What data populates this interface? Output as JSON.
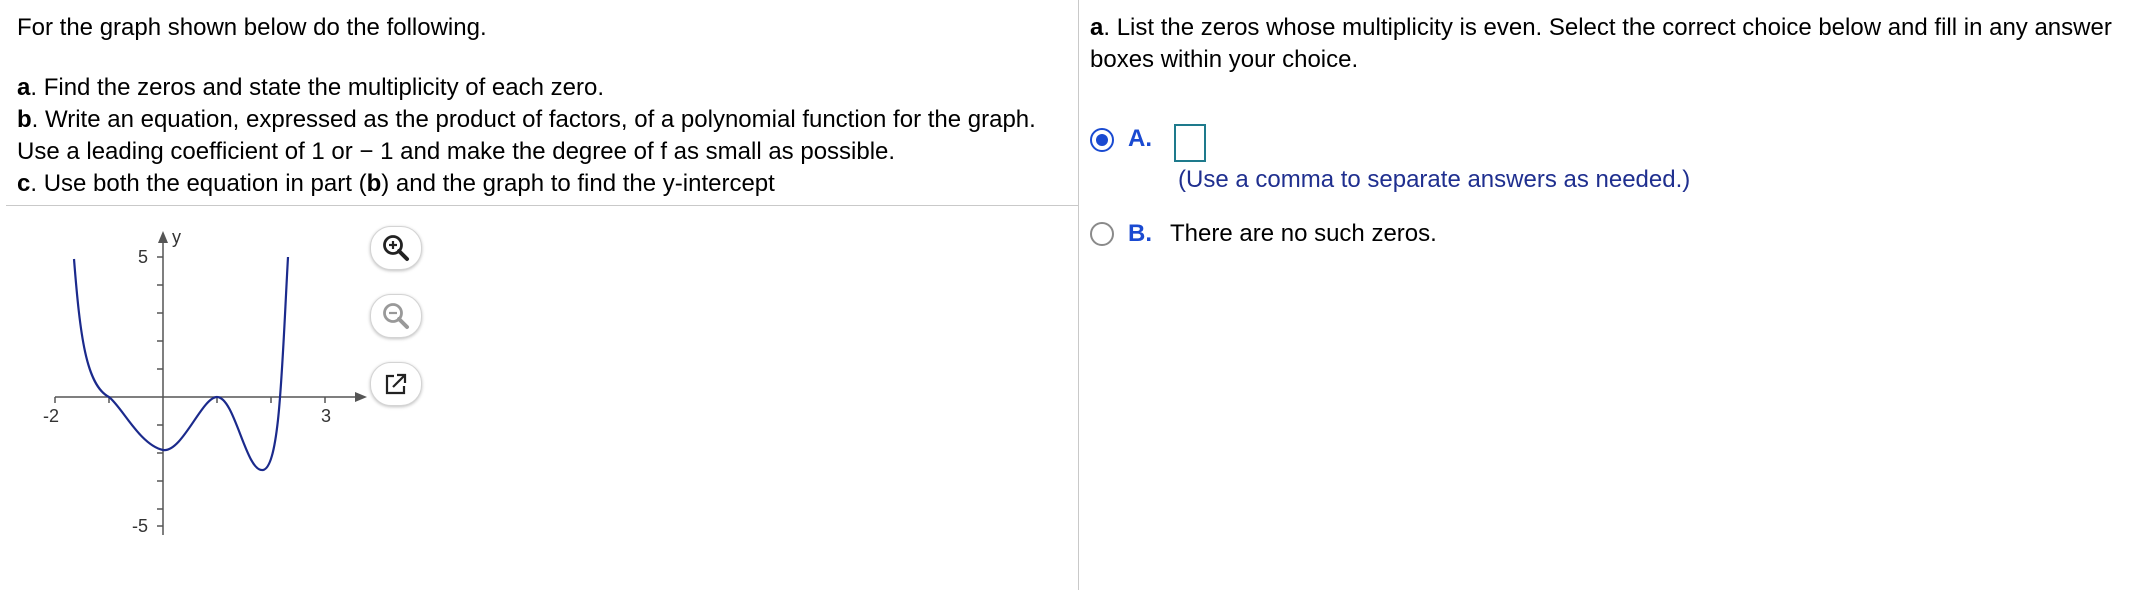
{
  "instructions": {
    "intro": "For the graph shown below do the following.",
    "a_letter": "a",
    "a_text": ". Find the zeros and state the multiplicity of each zero.",
    "b_letter": "b",
    "b_text": ". Write an equation, expressed as the product of factors, of a polynomial function for the graph. Use a leading coefficient of 1 or − 1 and make the degree of f as small as possible.",
    "c_letter": "c",
    "c_text_1": ". Use both the equation in part (",
    "c_bold": "b",
    "c_text_2": ") and the graph to find the y-intercept"
  },
  "graph": {
    "y_axis_label": "y",
    "tick_y_top": "5",
    "tick_y_bottom": "-5",
    "tick_x_left": "-2",
    "tick_x_right": "3",
    "curve_color": "#1b2a8c"
  },
  "tools": {
    "zoom_in_icon": "zoom-in-icon",
    "zoom_out_icon": "zoom-out-icon",
    "popout_icon": "external-link-icon"
  },
  "question": {
    "letter": "a",
    "text": ". List the zeros whose multiplicity is even. Select the correct choice below and fill in any answer boxes within your choice."
  },
  "choices": {
    "a_label": "A.",
    "a_selected": true,
    "a_value": "",
    "hint": "(Use a comma to separate answers as needed.)",
    "b_label": "B.",
    "b_text": "There are no such zeros.",
    "b_selected": false
  },
  "colors": {
    "accent": "#1a4ad1",
    "hint": "#1f2f8f",
    "answer_box_border": "#1e7a8c"
  }
}
